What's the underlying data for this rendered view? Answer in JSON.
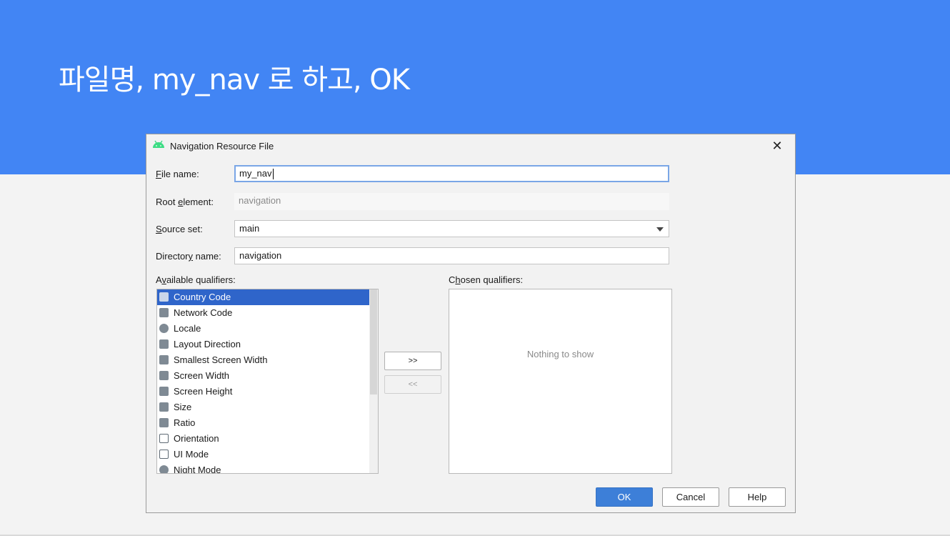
{
  "slide": {
    "title": "파일명, my_nav 로 하고, OK"
  },
  "dialog": {
    "title": "Navigation Resource File",
    "close_glyph": "✕",
    "file_name": {
      "label_hot": "F",
      "label_rest": "ile name:",
      "value": "my_nav"
    },
    "root_element": {
      "label_pre": "Root ",
      "label_hot": "e",
      "label_rest": "lement:",
      "placeholder": "navigation"
    },
    "source_set": {
      "label_hot": "S",
      "label_rest": "ource set:",
      "value": "main"
    },
    "directory_name": {
      "label_pre": "Director",
      "label_hot": "y",
      "label_rest": " name:",
      "value": "navigation"
    },
    "available": {
      "label_pre": "A",
      "label_hot": "v",
      "label_rest": "ailable qualifiers:",
      "items": [
        {
          "label": "Country Code"
        },
        {
          "label": "Network Code"
        },
        {
          "label": "Locale"
        },
        {
          "label": "Layout Direction"
        },
        {
          "label": "Smallest Screen Width"
        },
        {
          "label": "Screen Width"
        },
        {
          "label": "Screen Height"
        },
        {
          "label": "Size"
        },
        {
          "label": "Ratio"
        },
        {
          "label": "Orientation"
        },
        {
          "label": "UI Mode"
        },
        {
          "label": "Night Mode"
        }
      ]
    },
    "add_label": ">>",
    "remove_label": "<<",
    "chosen": {
      "label_pre": "C",
      "label_hot": "h",
      "label_rest": "osen qualifiers:",
      "empty_text": "Nothing to show"
    },
    "ok_label": "OK",
    "cancel_label": "Cancel",
    "help_label": "Help"
  },
  "colors": {
    "banner": "#4285f4",
    "selection": "#2f65ca",
    "primary_button": "#3d7fd8"
  }
}
